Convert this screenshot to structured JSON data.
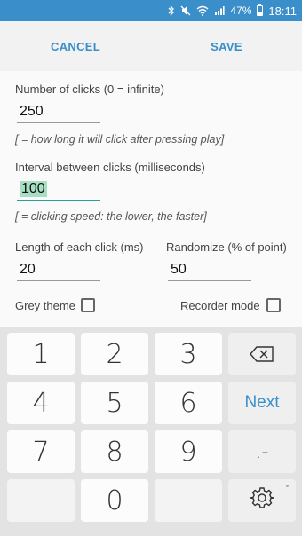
{
  "status_bar": {
    "battery": "47%",
    "time": "18:11",
    "icons": [
      "bluetooth-icon",
      "mute-icon",
      "wifi-icon",
      "signal-icon",
      "battery-icon"
    ]
  },
  "action_bar": {
    "cancel": "CANCEL",
    "save": "SAVE"
  },
  "form": {
    "clicks_label": "Number of clicks (0 = infinite)",
    "clicks_value": "250",
    "clicks_hint": "[ = how long it will click after pressing play]",
    "interval_label": "Interval between clicks (milliseconds)",
    "interval_value": "100",
    "interval_hint": "[ = clicking speed: the lower, the faster]",
    "length_label": "Length of each click (ms)",
    "length_value": "20",
    "randomize_label": "Randomize (% of point)",
    "randomize_value": "50",
    "grey_theme_label": "Grey theme",
    "grey_theme_checked": false,
    "recorder_label": "Recorder mode",
    "recorder_checked": false
  },
  "keyboard": {
    "rows": [
      [
        "1",
        "2",
        "3",
        "backspace"
      ],
      [
        "4",
        "5",
        "6",
        "Next"
      ],
      [
        "7",
        "8",
        "9",
        ".-"
      ],
      [
        "",
        "0",
        "",
        "settings"
      ]
    ],
    "next_label": "Next",
    "symbol_label": ".-",
    "accent": "#3a8ec9"
  }
}
